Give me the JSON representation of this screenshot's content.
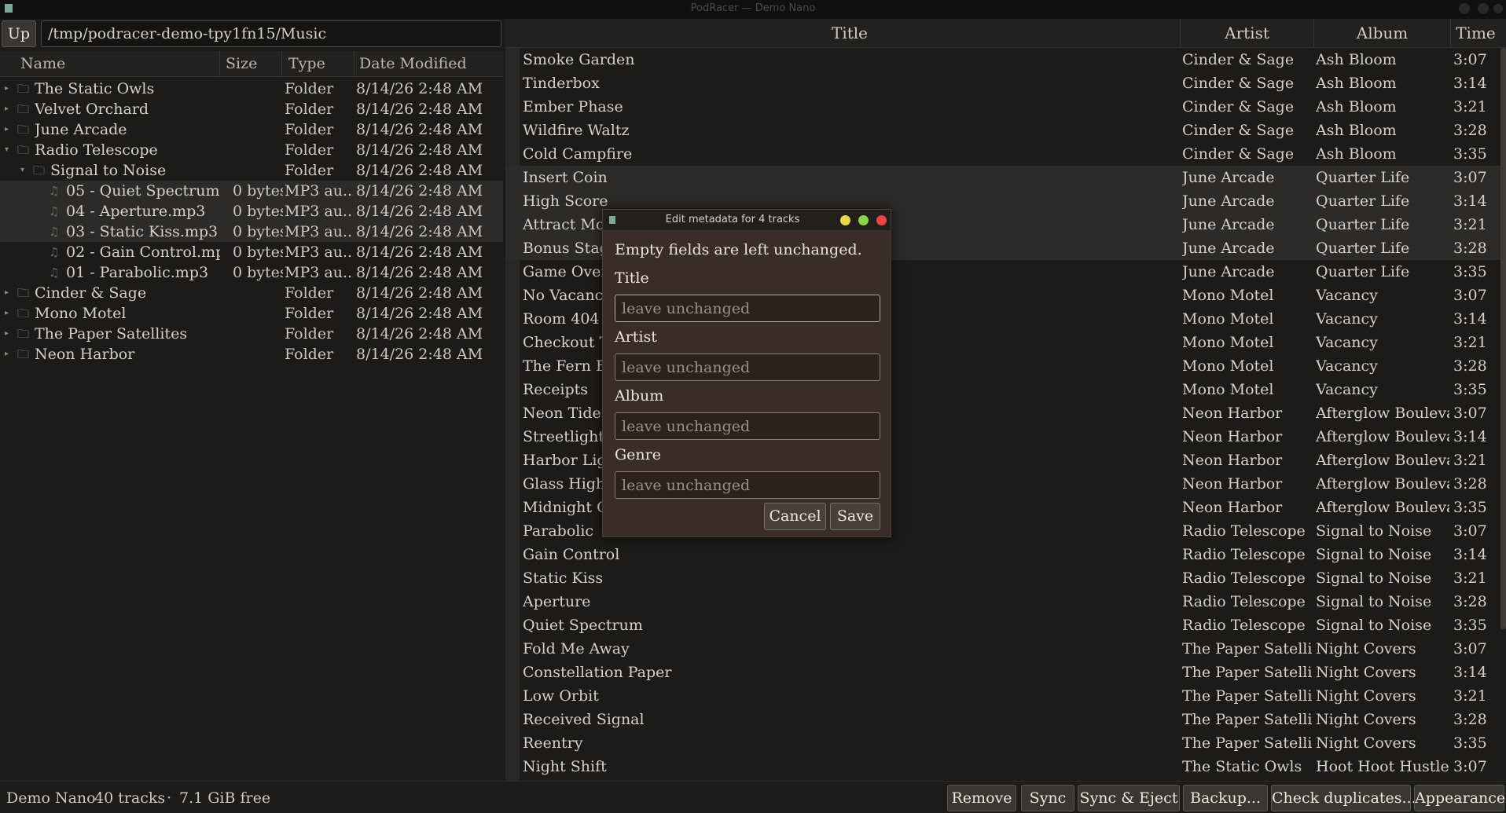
{
  "window": {
    "title": "PodRacer — Demo Nano"
  },
  "browser": {
    "up_label": "Up",
    "path": "/tmp/podracer-demo-tpy1fn15/Music",
    "columns": [
      "Name",
      "Size",
      "Type",
      "Date Modified"
    ],
    "rows": [
      {
        "level": 0,
        "kind": "folder",
        "expander": "▸",
        "name": "The Static Owls",
        "size": "",
        "type": "Folder",
        "date": "8/14/26 2:48 AM",
        "selected": false
      },
      {
        "level": 0,
        "kind": "folder",
        "expander": "▸",
        "name": "Velvet Orchard",
        "size": "",
        "type": "Folder",
        "date": "8/14/26 2:48 AM",
        "selected": false
      },
      {
        "level": 0,
        "kind": "folder",
        "expander": "▸",
        "name": "June Arcade",
        "size": "",
        "type": "Folder",
        "date": "8/14/26 2:48 AM",
        "selected": false
      },
      {
        "level": 0,
        "kind": "folder",
        "expander": "▾",
        "name": "Radio Telescope",
        "size": "",
        "type": "Folder",
        "date": "8/14/26 2:48 AM",
        "selected": false
      },
      {
        "level": 1,
        "kind": "folder",
        "expander": "▾",
        "name": "Signal to Noise",
        "size": "",
        "type": "Folder",
        "date": "8/14/26 2:48 AM",
        "selected": false
      },
      {
        "level": 2,
        "kind": "file",
        "expander": "",
        "name": "05 - Quiet Spectrum...",
        "size": "0 bytes",
        "type": "MP3 au...",
        "date": "8/14/26 2:48 AM",
        "selected": true
      },
      {
        "level": 2,
        "kind": "file",
        "expander": "",
        "name": "04 - Aperture.mp3",
        "size": "0 bytes",
        "type": "MP3 au...",
        "date": "8/14/26 2:48 AM",
        "selected": true
      },
      {
        "level": 2,
        "kind": "file",
        "expander": "",
        "name": "03 - Static Kiss.mp3",
        "size": "0 bytes",
        "type": "MP3 au...",
        "date": "8/14/26 2:48 AM",
        "selected": true
      },
      {
        "level": 2,
        "kind": "file",
        "expander": "",
        "name": "02 - Gain Control.mp3",
        "size": "0 bytes",
        "type": "MP3 au...",
        "date": "8/14/26 2:48 AM",
        "selected": false
      },
      {
        "level": 2,
        "kind": "file",
        "expander": "",
        "name": "01 - Parabolic.mp3",
        "size": "0 bytes",
        "type": "MP3 au...",
        "date": "8/14/26 2:48 AM",
        "selected": false
      },
      {
        "level": 0,
        "kind": "folder",
        "expander": "▸",
        "name": "Cinder & Sage",
        "size": "",
        "type": "Folder",
        "date": "8/14/26 2:48 AM",
        "selected": false
      },
      {
        "level": 0,
        "kind": "folder",
        "expander": "▸",
        "name": "Mono Motel",
        "size": "",
        "type": "Folder",
        "date": "8/14/26 2:48 AM",
        "selected": false
      },
      {
        "level": 0,
        "kind": "folder",
        "expander": "▸",
        "name": "The Paper Satellites",
        "size": "",
        "type": "Folder",
        "date": "8/14/26 2:48 AM",
        "selected": false
      },
      {
        "level": 0,
        "kind": "folder",
        "expander": "▸",
        "name": "Neon Harbor",
        "size": "",
        "type": "Folder",
        "date": "8/14/26 2:48 AM",
        "selected": false
      }
    ]
  },
  "tracks": {
    "columns": [
      "Title",
      "Artist",
      "Album",
      "Time"
    ],
    "rows": [
      {
        "title": "Smoke Garden",
        "artist": "Cinder & Sage",
        "album": "Ash Bloom",
        "time": "3:07",
        "selected": false
      },
      {
        "title": "Tinderbox",
        "artist": "Cinder & Sage",
        "album": "Ash Bloom",
        "time": "3:14",
        "selected": false
      },
      {
        "title": "Ember Phase",
        "artist": "Cinder & Sage",
        "album": "Ash Bloom",
        "time": "3:21",
        "selected": false
      },
      {
        "title": "Wildfire Waltz",
        "artist": "Cinder & Sage",
        "album": "Ash Bloom",
        "time": "3:28",
        "selected": false
      },
      {
        "title": "Cold Campfire",
        "artist": "Cinder & Sage",
        "album": "Ash Bloom",
        "time": "3:35",
        "selected": false
      },
      {
        "title": "Insert Coin",
        "artist": "June Arcade",
        "album": "Quarter Life",
        "time": "3:07",
        "selected": true
      },
      {
        "title": "High Score",
        "artist": "June Arcade",
        "album": "Quarter Life",
        "time": "3:14",
        "selected": true
      },
      {
        "title": "Attract Mode",
        "artist": "June Arcade",
        "album": "Quarter Life",
        "time": "3:21",
        "selected": true
      },
      {
        "title": "Bonus Stage",
        "artist": "June Arcade",
        "album": "Quarter Life",
        "time": "3:28",
        "selected": true
      },
      {
        "title": "Game Over S",
        "artist": "June Arcade",
        "album": "Quarter Life",
        "time": "3:35",
        "selected": false
      },
      {
        "title": "No Vacancy",
        "artist": "Mono Motel",
        "album": "Vacancy",
        "time": "3:07",
        "selected": false
      },
      {
        "title": "Room 404",
        "artist": "Mono Motel",
        "album": "Vacancy",
        "time": "3:14",
        "selected": false
      },
      {
        "title": "Checkout Tir",
        "artist": "Mono Motel",
        "album": "Vacancy",
        "time": "3:21",
        "selected": false
      },
      {
        "title": "The Fern Bar",
        "artist": "Mono Motel",
        "album": "Vacancy",
        "time": "3:28",
        "selected": false
      },
      {
        "title": "Receipts",
        "artist": "Mono Motel",
        "album": "Vacancy",
        "time": "3:35",
        "selected": false
      },
      {
        "title": "Neon Tides",
        "artist": "Neon Harbor",
        "album": "Afterglow Boulevard",
        "time": "3:07",
        "selected": false
      },
      {
        "title": "Streetlight S",
        "artist": "Neon Harbor",
        "album": "Afterglow Boulevard",
        "time": "3:14",
        "selected": false
      },
      {
        "title": "Harbor Light",
        "artist": "Neon Harbor",
        "album": "Afterglow Boulevard",
        "time": "3:21",
        "selected": false
      },
      {
        "title": "Glass Highwa",
        "artist": "Neon Harbor",
        "album": "Afterglow Boulevard",
        "time": "3:28",
        "selected": false
      },
      {
        "title": "Midnight Cor",
        "artist": "Neon Harbor",
        "album": "Afterglow Boulevard",
        "time": "3:35",
        "selected": false
      },
      {
        "title": "Parabolic",
        "artist": "Radio Telescope",
        "album": "Signal to Noise",
        "time": "3:07",
        "selected": false
      },
      {
        "title": "Gain Control",
        "artist": "Radio Telescope",
        "album": "Signal to Noise",
        "time": "3:14",
        "selected": false
      },
      {
        "title": "Static Kiss",
        "artist": "Radio Telescope",
        "album": "Signal to Noise",
        "time": "3:21",
        "selected": false
      },
      {
        "title": "Aperture",
        "artist": "Radio Telescope",
        "album": "Signal to Noise",
        "time": "3:28",
        "selected": false
      },
      {
        "title": "Quiet Spectrum",
        "artist": "Radio Telescope",
        "album": "Signal to Noise",
        "time": "3:35",
        "selected": false
      },
      {
        "title": "Fold Me Away",
        "artist": "The Paper Satellites",
        "album": "Night Covers",
        "time": "3:07",
        "selected": false
      },
      {
        "title": "Constellation Paper",
        "artist": "The Paper Satellites",
        "album": "Night Covers",
        "time": "3:14",
        "selected": false
      },
      {
        "title": "Low Orbit",
        "artist": "The Paper Satellites",
        "album": "Night Covers",
        "time": "3:21",
        "selected": false
      },
      {
        "title": "Received Signal",
        "artist": "The Paper Satellites",
        "album": "Night Covers",
        "time": "3:28",
        "selected": false
      },
      {
        "title": "Reentry",
        "artist": "The Paper Satellites",
        "album": "Night Covers",
        "time": "3:35",
        "selected": false
      },
      {
        "title": "Night Shift",
        "artist": "The Static Owls",
        "album": "Hoot Hoot Hustle",
        "time": "3:07",
        "selected": false
      }
    ]
  },
  "status": {
    "device": "Demo Nano",
    "tracks": "40 tracks",
    "separator": "·",
    "free": "7.1 GiB free"
  },
  "toolbar": {
    "remove": "Remove",
    "sync": "Sync",
    "sync_eject": "Sync & Eject",
    "backup": "Backup...",
    "check_duplicates": "Check duplicates...",
    "appearance": "Appearance"
  },
  "dialog": {
    "title": "Edit metadata for 4 tracks",
    "message": "Empty fields are left unchanged.",
    "fields": [
      {
        "label": "Title",
        "placeholder": "leave unchanged",
        "value": ""
      },
      {
        "label": "Artist",
        "placeholder": "leave unchanged",
        "value": ""
      },
      {
        "label": "Album",
        "placeholder": "leave unchanged",
        "value": ""
      },
      {
        "label": "Genre",
        "placeholder": "leave unchanged",
        "value": ""
      }
    ],
    "cancel": "Cancel",
    "save": "Save",
    "colors": {
      "minimize": "#e8d84a",
      "maximize": "#8bd34a",
      "close": "#e84545"
    }
  }
}
